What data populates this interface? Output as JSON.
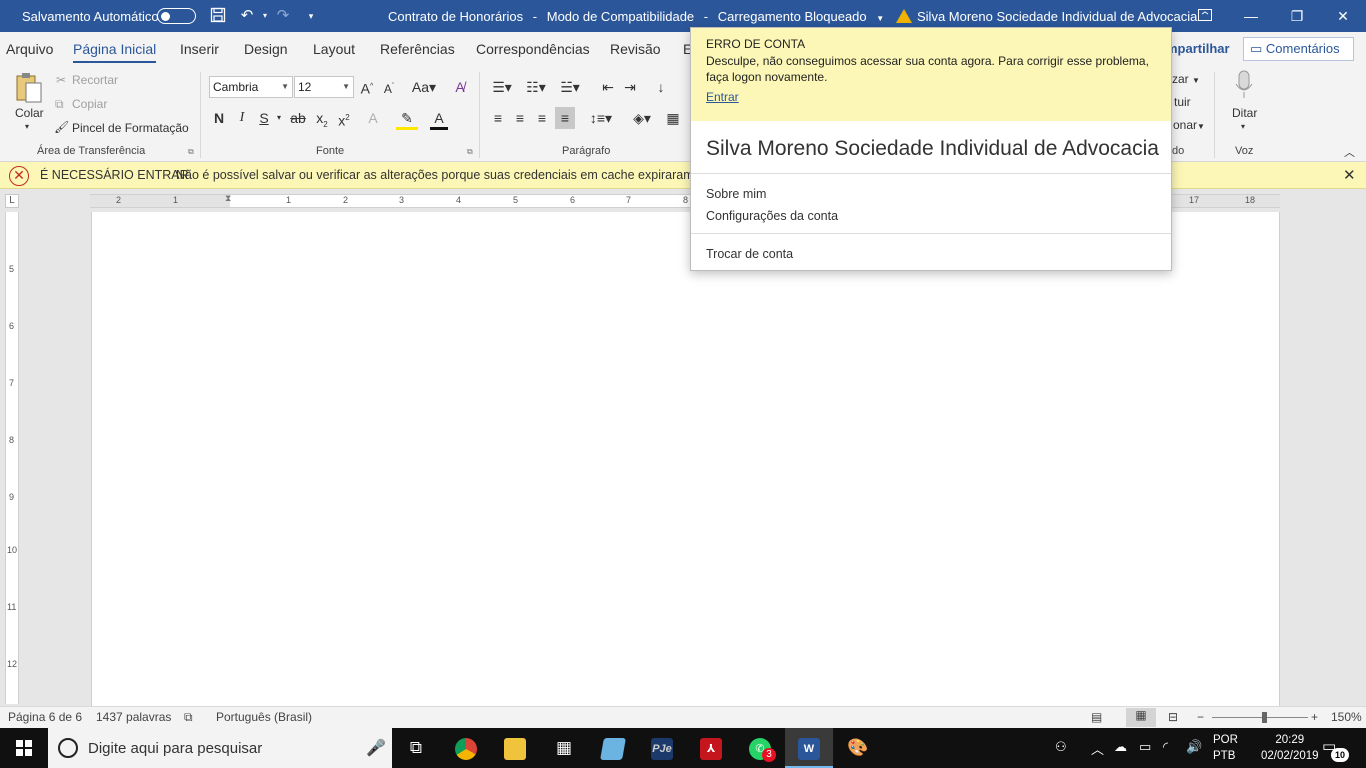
{
  "titlebar": {
    "autosave_label": "Salvamento Automático",
    "doc_name": "Contrato de Honorários",
    "separator": "-",
    "mode": "Modo de Compatibilidade",
    "load_status": "Carregamento Bloqueado",
    "user": "Silva Moreno Sociedade Individual de Advocacia"
  },
  "tabs": [
    "Arquivo",
    "Página Inicial",
    "Inserir",
    "Design",
    "Layout",
    "Referências",
    "Correspondências",
    "Revisão",
    "E"
  ],
  "share_label": "mpartilhar",
  "comments_label": "Comentários",
  "ribbon": {
    "clipboard": {
      "paste": "Colar",
      "cut": "Recortar",
      "copy": "Copiar",
      "format_painter": "Pincel de Formatação",
      "group": "Área de Transferência"
    },
    "font": {
      "name": "Cambria",
      "size": "12",
      "group": "Fonte"
    },
    "paragraph": {
      "group": "Parágrafo"
    },
    "editing": {
      "line1": "zar",
      "line2": "tuir",
      "line3": "onar",
      "group": "do"
    },
    "voice": {
      "dictate": "Ditar",
      "group": "Voz"
    }
  },
  "message_bar": {
    "title": "É NECESSÁRIO ENTRAR",
    "text": "Não é possível salvar ou verificar as alterações porque suas credenciais em cache expiraram. Entre"
  },
  "ruler": {
    "left_numbers": [
      "2",
      "1"
    ],
    "numbers": [
      "1",
      "2",
      "3",
      "4",
      "5",
      "6",
      "7",
      "8"
    ],
    "right_numbers": [
      "17",
      "18"
    ],
    "vertical_numbers": [
      "5",
      "6",
      "7",
      "8",
      "9",
      "10",
      "11",
      "12"
    ]
  },
  "account_popup": {
    "error_title": "ERRO DE CONTA",
    "error_text": "Desculpe, não conseguimos acessar sua conta agora. Para corrigir esse problema, faça logon novamente.",
    "signin": "Entrar",
    "name": "Silva Moreno Sociedade Individual de Advocacia",
    "about": "Sobre mim",
    "settings": "Configurações da conta",
    "switch": "Trocar de conta"
  },
  "statusbar": {
    "page": "Página 6 de 6",
    "words": "1437 palavras",
    "language": "Português (Brasil)",
    "zoom": "150%"
  },
  "taskbar": {
    "search_placeholder": "Digite aqui para pesquisar",
    "whatsapp_badge": "3",
    "lang_top": "POR",
    "lang_bottom": "PTB",
    "time": "20:29",
    "date": "02/02/2019",
    "notifications": "10"
  }
}
